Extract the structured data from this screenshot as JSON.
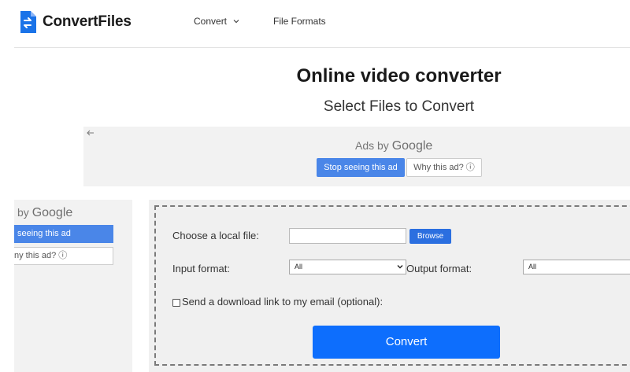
{
  "header": {
    "logo_text": "ConvertFiles",
    "nav": [
      {
        "label": "Convert"
      },
      {
        "label": "File Formats"
      }
    ]
  },
  "main": {
    "title": "Online video converter",
    "subtitle": "Select Files to Convert"
  },
  "ad_top": {
    "ads_by": "Ads by ",
    "google": "Google",
    "stop_label": "Stop seeing this ad",
    "why_label": "Why this ad? ⓘ"
  },
  "ad_left": {
    "ads_by": "by ",
    "google": "Google",
    "stop_label": "seeing this ad",
    "why_label": "ny this ad? ⓘ"
  },
  "form": {
    "local_file_label": "Choose a local file:",
    "file_value": "",
    "browse_label": "Browse",
    "input_format_label": "Input format:",
    "input_format_value": "All",
    "output_format_label": "Output format:",
    "output_format_value": "All",
    "email_label": "Send a download link to my email (optional):",
    "convert_label": "Convert"
  },
  "colors": {
    "primary_button": "#0d6efd",
    "ad_button": "#4a86e8",
    "logo_blue": "#1a73e8"
  }
}
